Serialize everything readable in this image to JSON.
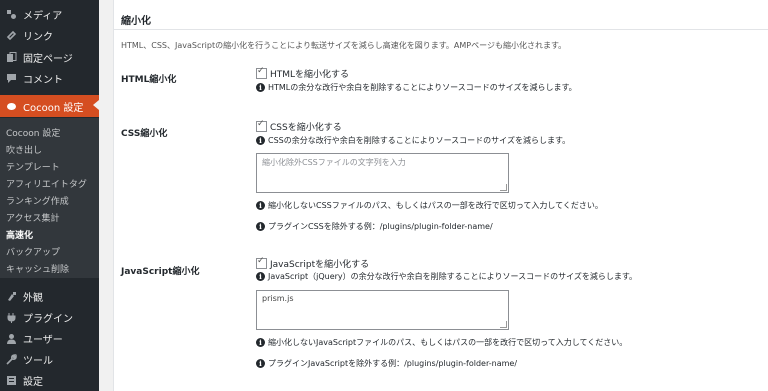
{
  "sidebar": {
    "top_items": [
      {
        "label": "メディア",
        "icon": "media-icon"
      },
      {
        "label": "リンク",
        "icon": "link-icon"
      },
      {
        "label": "固定ページ",
        "icon": "pages-icon"
      },
      {
        "label": "コメント",
        "icon": "comment-icon"
      },
      {
        "label": "Cocoon 設定",
        "icon": "cocoon-icon"
      }
    ],
    "submenu": [
      "Cocoon 設定",
      "吹き出し",
      "テンプレート",
      "アフィリエイトタグ",
      "ランキング作成",
      "アクセス集計",
      "高速化",
      "バックアップ",
      "キャッシュ削除"
    ],
    "bottom_items": [
      {
        "label": "外観",
        "icon": "appearance-icon"
      },
      {
        "label": "プラグイン",
        "icon": "plugins-icon"
      },
      {
        "label": "ユーザー",
        "icon": "users-icon"
      },
      {
        "label": "ツール",
        "icon": "tools-icon"
      },
      {
        "label": "設定",
        "icon": "settings-icon"
      }
    ],
    "accent_color": "#d54e21"
  },
  "panel": {
    "title": "縮小化",
    "description": "HTML、CSS、JavaScriptの縮小化を行うことにより転送サイズを減らし高速化を図ります。AMPページも縮小化されます。",
    "html": {
      "label": "HTML縮小化",
      "checkbox_label": "HTMLを縮小化する",
      "checked": true,
      "note": "HTMLの余分な改行や余白を削除することによりソースコードのサイズを減らします。"
    },
    "css": {
      "label": "CSS縮小化",
      "checkbox_label": "CSSを縮小化する",
      "checked": true,
      "note": "CSSの余分な改行や余白を削除することによりソースコードのサイズを減らします。",
      "textarea_placeholder": "縮小化除外CSSファイルの文字列を入力",
      "textarea_value": "",
      "exclude_note": "縮小化しないCSSファイルのパス、もしくはパスの一部を改行で区切って入力してください。",
      "example_note": "プラグインCSSを除外する例：/plugins/plugin-folder-name/"
    },
    "js": {
      "label": "JavaScript縮小化",
      "checkbox_label": "JavaScriptを縮小化する",
      "checked": true,
      "note": "JavaScript（jQuery）の余分な改行や余白を削除することによりソースコードのサイズを減らします。",
      "textarea_value": "prism.js",
      "exclude_note": "縮小化しないJavaScriptファイルのパス、もしくはパスの一部を改行で区切って入力してください。",
      "example_note": "プラグインJavaScriptを除外する例：/plugins/plugin-folder-name/"
    }
  }
}
